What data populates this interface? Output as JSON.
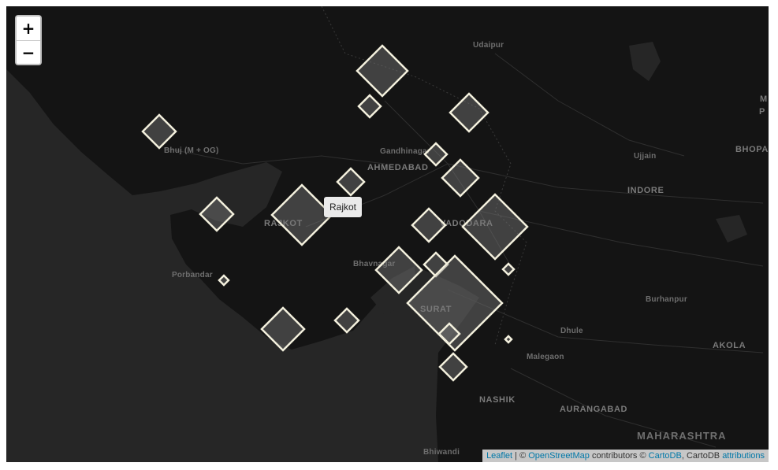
{
  "cities": [
    {
      "label": "Udaipur",
      "cls": ""
    },
    {
      "label": "Bhuj (M + OG)",
      "cls": ""
    },
    {
      "label": "Gandhinagar",
      "cls": ""
    },
    {
      "label": "AHMEDABAD",
      "cls": "big"
    },
    {
      "label": "Ujjain",
      "cls": ""
    },
    {
      "label": "BHOPA",
      "cls": "big"
    },
    {
      "label": "INDORE",
      "cls": "big"
    },
    {
      "label": "RAJKOT",
      "cls": "big"
    },
    {
      "label": "VADODARA",
      "cls": "big"
    },
    {
      "label": "Porbandar",
      "cls": ""
    },
    {
      "label": "Bhavnagar",
      "cls": ""
    },
    {
      "label": "Burhanpur",
      "cls": ""
    },
    {
      "label": "SURAT",
      "cls": "big"
    },
    {
      "label": "Dhule",
      "cls": ""
    },
    {
      "label": "AKOLA",
      "cls": "big"
    },
    {
      "label": "Malegaon",
      "cls": ""
    },
    {
      "label": "NASHIK",
      "cls": "big"
    },
    {
      "label": "AURANGABAD",
      "cls": "big"
    },
    {
      "label": "MAHARASHTRA",
      "cls": "state"
    },
    {
      "label": "Bhiwandi",
      "cls": ""
    },
    {
      "label": "M",
      "cls": "big"
    },
    {
      "label": "P",
      "cls": "big"
    }
  ],
  "zoom": {
    "in_label": "+",
    "out_label": "−"
  },
  "tooltip": {
    "text": "Rajkot"
  },
  "attribution": {
    "leaflet": "Leaflet",
    "sep1": " | © ",
    "osm": "OpenStreetMap",
    "mid": " contributors © ",
    "cartodb": "CartoDB",
    "mid2": ", CartoDB ",
    "attributions": "attributions"
  }
}
